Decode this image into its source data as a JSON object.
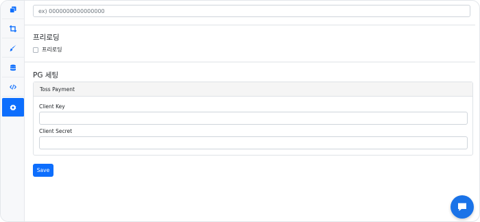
{
  "sidebar": {
    "items": [
      {
        "icon": "copy-icon"
      },
      {
        "icon": "crop-icon"
      },
      {
        "icon": "brush-icon"
      },
      {
        "icon": "database-icon"
      },
      {
        "icon": "code-icon"
      },
      {
        "icon": "gear-icon",
        "active": true
      }
    ]
  },
  "top_input": {
    "placeholder": "ex) 0000000000000000"
  },
  "prerender": {
    "title": "프리로딩",
    "checkbox_label": "프리로딩",
    "checked": false
  },
  "pg": {
    "title": "PG 세팅",
    "card_title": "Toss Payment",
    "client_key_label": "Client Key",
    "client_key_value": "",
    "client_secret_label": "Client Secret",
    "client_secret_value": ""
  },
  "actions": {
    "save_label": "Save"
  },
  "colors": {
    "accent": "#0d6efd",
    "chat": "#1a73e8"
  }
}
